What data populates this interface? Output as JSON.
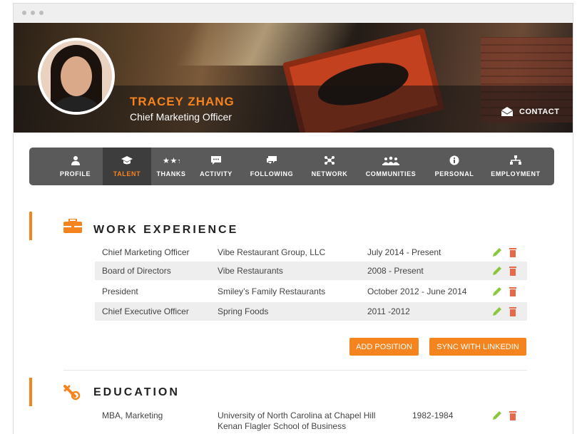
{
  "profile": {
    "name": "TRACEY ZHANG",
    "title": "Chief Marketing Officer",
    "contact_label": "CONTACT"
  },
  "nav": {
    "tabs": [
      {
        "label": "PROFILE",
        "icon": "person-icon",
        "active": false
      },
      {
        "label": "TALENT",
        "icon": "graduation-cap-icon",
        "active": true
      },
      {
        "label": "THANKS",
        "icon": "stars-icon",
        "active": false
      },
      {
        "label": "ACTIVITY",
        "icon": "speech-bubble-icon",
        "active": false
      },
      {
        "label": "FOLLOWING",
        "icon": "chat-bubbles-icon",
        "active": false
      },
      {
        "label": "NETWORK",
        "icon": "network-icon",
        "active": false
      },
      {
        "label": "COMMUNITIES",
        "icon": "group-icon",
        "active": false
      },
      {
        "label": "PERSONAL",
        "icon": "info-icon",
        "active": false
      },
      {
        "label": "EMPLOYMENT",
        "icon": "org-chart-icon",
        "active": false
      }
    ]
  },
  "work": {
    "title": "WORK EXPERIENCE",
    "rows": [
      {
        "position": "Chief Marketing Officer",
        "company": "Vibe Restaurant Group, LLC",
        "dates": "July 2014 - Present"
      },
      {
        "position": "Board of Directors",
        "company": "Vibe Restaurants",
        "dates": "2008 - Present"
      },
      {
        "position": "President",
        "company": "Smiley’s Family Restaurants",
        "dates": "October 2012 - June 2014"
      },
      {
        "position": "Chief Executive Officer",
        "company": "Spring Foods",
        "dates": "2011 -2012"
      }
    ],
    "add_label": "ADD POSITION",
    "sync_label": "SYNC WITH LINKEDIN"
  },
  "education": {
    "title": "EDUCATION",
    "rows": [
      {
        "degree": "MBA, Marketing",
        "school": "University of North Carolina at Chapel Hill",
        "school2": "Kenan Flagler School of Business",
        "dates": "1982-1984"
      }
    ]
  },
  "colors": {
    "accent": "#f5841f",
    "nav_bg": "#5a5a5a",
    "nav_active": "#3d3d3d",
    "edit": "#8cc63f",
    "delete": "#e8684a"
  }
}
